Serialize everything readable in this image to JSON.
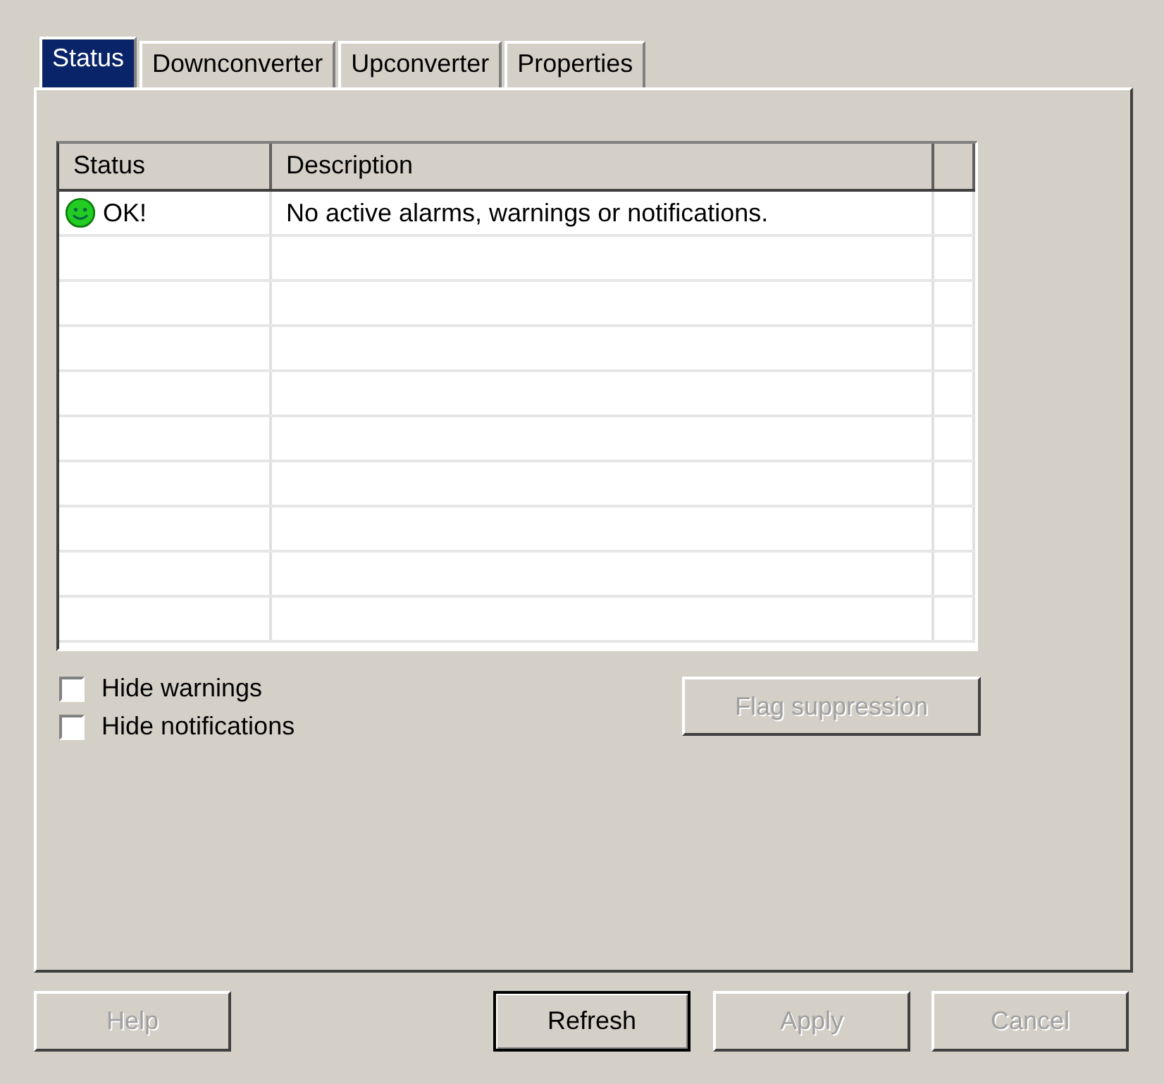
{
  "tabs": [
    {
      "label": "Status",
      "selected": true
    },
    {
      "label": "Downconverter",
      "selected": false
    },
    {
      "label": "Upconverter",
      "selected": false
    },
    {
      "label": "Properties",
      "selected": false
    }
  ],
  "table": {
    "columns": [
      "Status",
      "Description"
    ],
    "rows": [
      {
        "kind": "ok",
        "status": "OK!",
        "description": "No active alarms, warnings or notifications."
      }
    ]
  },
  "options": [
    {
      "label": "Hide warnings",
      "checked": false
    },
    {
      "label": "Hide notifications",
      "checked": false
    }
  ],
  "flag_button": {
    "label": "Flag suppression",
    "disabled": true
  },
  "buttons": [
    {
      "label": "Help",
      "disabled": true,
      "default": false
    },
    {
      "label": "Refresh",
      "disabled": false,
      "default": true
    },
    {
      "label": "Apply",
      "disabled": true,
      "default": false
    },
    {
      "label": "Cancel",
      "disabled": true,
      "default": false
    }
  ]
}
